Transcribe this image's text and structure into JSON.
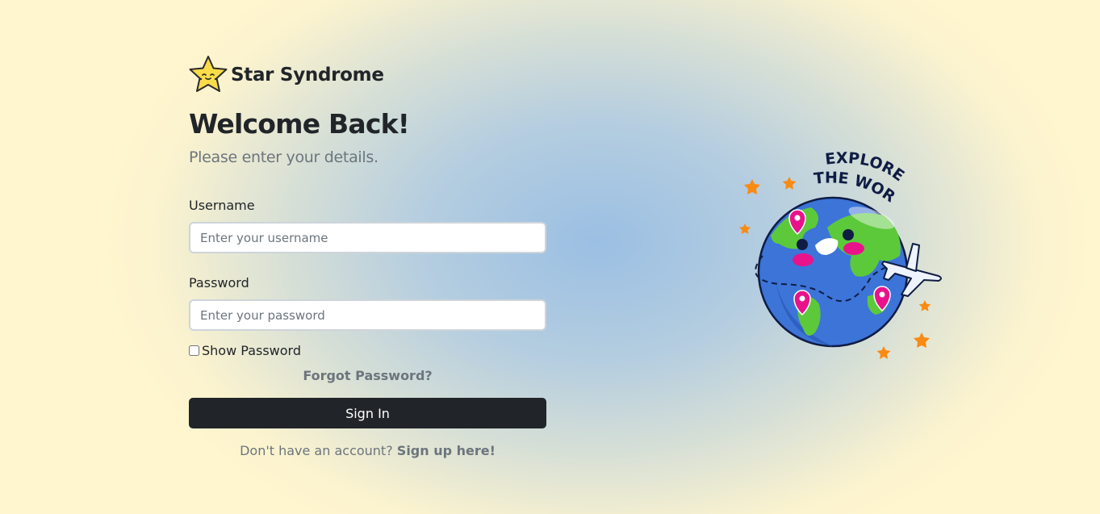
{
  "brand": {
    "name": "Star Syndrome",
    "logo_icon": "star-face-icon"
  },
  "heading": {
    "title": "Welcome Back!",
    "subtitle": "Please enter your details."
  },
  "form": {
    "username_label": "Username",
    "username_placeholder": "Enter your username",
    "username_value": "",
    "password_label": "Password",
    "password_placeholder": "Enter your password",
    "password_value": "",
    "show_password_label": "Show Password",
    "show_password_checked": false,
    "forgot_link": "Forgot Password?",
    "signin_button": "Sign In"
  },
  "signup": {
    "prompt": "Don't have an account?",
    "link": "Sign up here!"
  },
  "illustration": {
    "icon": "globe-explore-icon",
    "text_line1": "EXPLORE",
    "text_line2": "THE WORLD"
  },
  "colors": {
    "button_bg": "#212529",
    "muted_text": "#6c757d",
    "star_yellow": "#f9dc4a",
    "accent_orange": "#f98a13",
    "pin_pink": "#e8138a",
    "ocean_blue": "#3c74d8",
    "land_green": "#5cc93b"
  }
}
